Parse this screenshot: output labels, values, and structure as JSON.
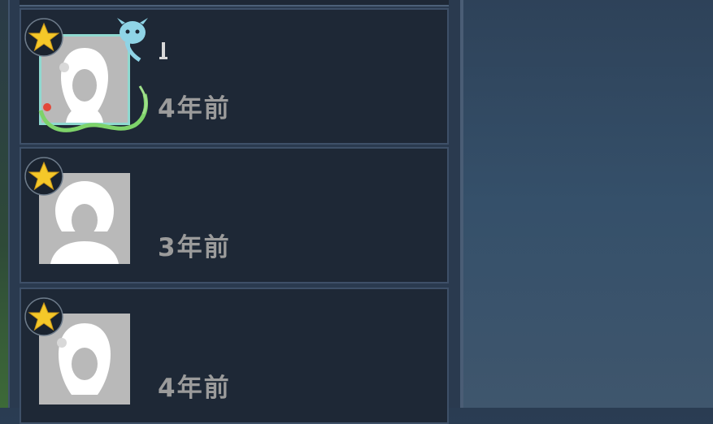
{
  "entries": [
    {
      "time_label": "4年前",
      "decorated_frame": true
    },
    {
      "time_label": "3年前",
      "decorated_frame": false
    },
    {
      "time_label": "4年前",
      "decorated_frame": false
    }
  ],
  "colors": {
    "panel": "#2a3a4f",
    "entry_background": "#1e2836",
    "time_text": "#9b9b9b",
    "avatar_placeholder": "#b9b9b9",
    "star": "#f5c829"
  },
  "icons": [
    "star-badge-icon",
    "avatar-silhouette",
    "vine-frame-decoration",
    "sprite-icon"
  ]
}
